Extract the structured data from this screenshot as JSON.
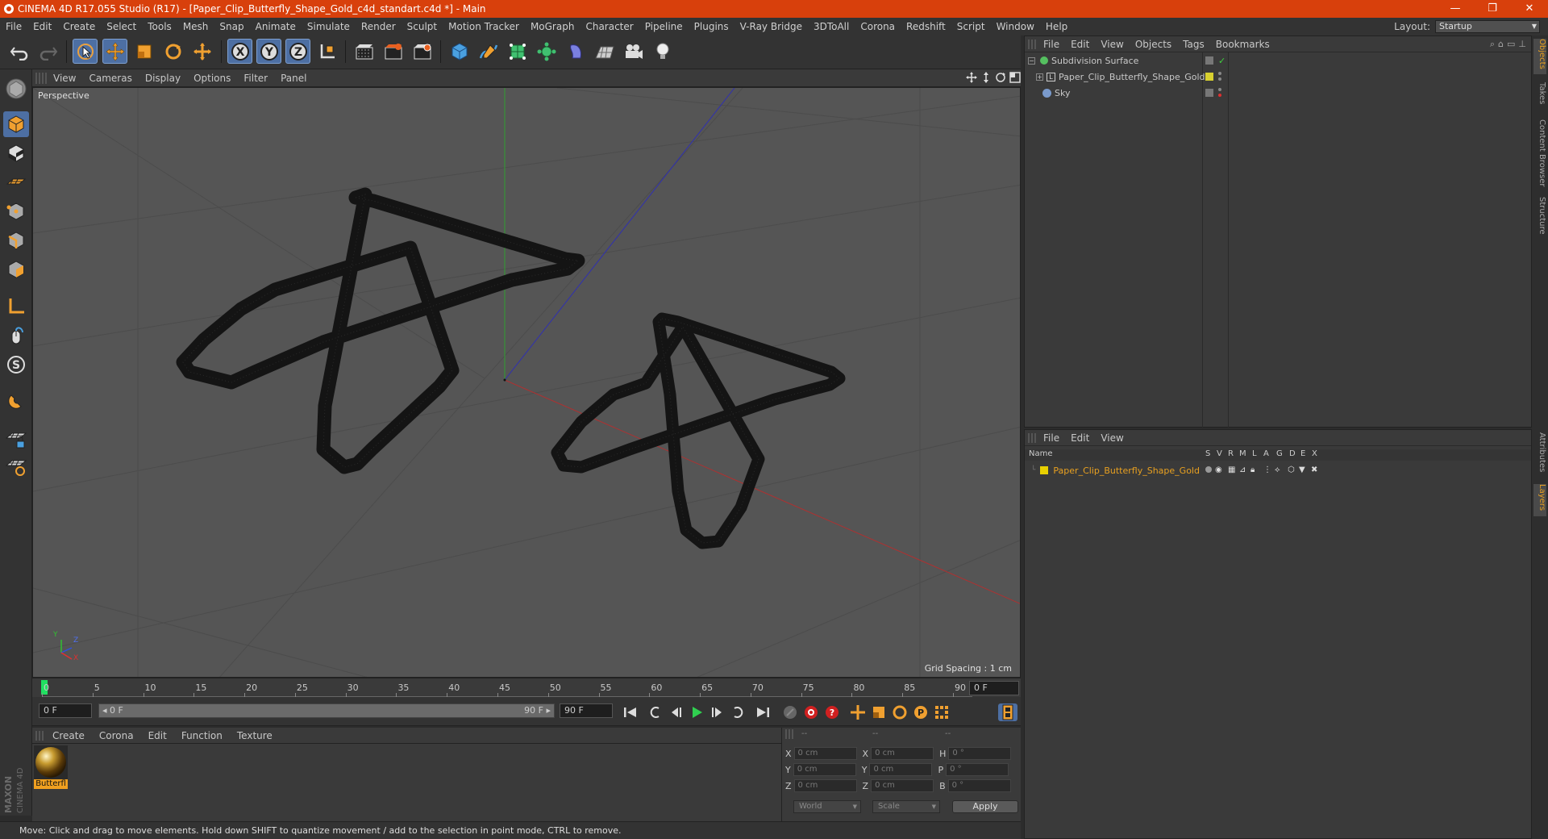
{
  "window": {
    "title": "CINEMA 4D R17.055 Studio (R17) - [Paper_Clip_Butterfly_Shape_Gold_c4d_standart.c4d *] - Main",
    "controls": [
      "—",
      "❐",
      "✕"
    ]
  },
  "menubar": [
    "File",
    "Edit",
    "Create",
    "Select",
    "Tools",
    "Mesh",
    "Snap",
    "Animate",
    "Simulate",
    "Render",
    "Sculpt",
    "Motion Tracker",
    "MoGraph",
    "Character",
    "Pipeline",
    "Plugins",
    "V-Ray Bridge",
    "3DToAll",
    "Corona",
    "Redshift",
    "Script",
    "Window",
    "Help"
  ],
  "layout": {
    "label": "Layout:",
    "value": "Startup"
  },
  "toolbar": {
    "icons": [
      "undo-icon",
      "redo-icon",
      "select-arrow-icon",
      "move-icon",
      "scale-icon",
      "rotate-icon",
      "transform-icon",
      "axis-x-icon",
      "axis-y-icon",
      "axis-z-icon",
      "coordinate-system-icon",
      "render-view-icon",
      "render-picture-viewer-icon",
      "render-settings-icon",
      "cube-primitive-icon",
      "pen-spline-icon",
      "subdivision-icon",
      "array-icon",
      "deformer-icon",
      "floor-icon",
      "camera-icon",
      "light-icon"
    ],
    "axis_labels": [
      "X",
      "Y",
      "Z"
    ]
  },
  "left_tools": [
    "make-editable-icon",
    "model-mode-icon",
    "texture-mode-icon",
    "workplane-mode-icon",
    "points-mode-icon",
    "edges-mode-icon",
    "polygons-mode-icon",
    "axis-mode-icon",
    "tweak-mode-icon",
    "solo-icon",
    "snap-icon",
    "lock-workplane-icon",
    "planar-workplane-icon"
  ],
  "solo_label": "S",
  "maxon_logo": "MAXON CINEMA 4D",
  "viewport": {
    "menu": [
      "View",
      "Cameras",
      "Display",
      "Options",
      "Filter",
      "Panel"
    ],
    "camera_label": "Perspective",
    "grid_spacing": "Grid Spacing : 1 cm",
    "axis_gizmo": {
      "y": "Y",
      "z": "Z",
      "x": "X"
    }
  },
  "timeline": {
    "ticks": [
      "0",
      "5",
      "10",
      "15",
      "20",
      "25",
      "30",
      "35",
      "40",
      "45",
      "50",
      "55",
      "60",
      "65",
      "70",
      "75",
      "80",
      "85",
      "90"
    ],
    "current_frame": "0 F"
  },
  "playbar": {
    "start_frame": "0 F",
    "range_start": "◂ 0 F",
    "range_end": "90 F ▸",
    "end_frame": "90 F"
  },
  "materials": {
    "menu": [
      "Create",
      "Corona",
      "Edit",
      "Function",
      "Texture"
    ],
    "items": [
      {
        "label": "Butterfl"
      }
    ]
  },
  "coordinates": {
    "headers": [
      "--",
      "--",
      "--"
    ],
    "rows": [
      {
        "a": "X",
        "av": "0 cm",
        "b": "X",
        "bv": "0 cm",
        "c": "H",
        "cv": "0 °"
      },
      {
        "a": "Y",
        "av": "0 cm",
        "b": "Y",
        "bv": "0 cm",
        "c": "P",
        "cv": "0 °"
      },
      {
        "a": "Z",
        "av": "0 cm",
        "b": "Z",
        "bv": "0 cm",
        "c": "B",
        "cv": "0 °"
      }
    ],
    "mode": "World",
    "scale": "Scale",
    "apply": "Apply"
  },
  "status": "Move: Click and drag to move elements. Hold down SHIFT to quantize movement / add to the selection in point mode, CTRL to remove.",
  "objects_panel": {
    "menu": [
      "File",
      "Edit",
      "View",
      "Objects",
      "Tags",
      "Bookmarks"
    ],
    "items": [
      {
        "name": "Subdivision Surface",
        "color": "#55c060"
      },
      {
        "name": "Paper_Clip_Butterfly_Shape_Gold",
        "color": "#d8d030"
      },
      {
        "name": "Sky",
        "color": "#7a9acc"
      }
    ]
  },
  "layers_panel": {
    "menu": [
      "File",
      "Edit",
      "View"
    ],
    "columns": [
      "Name",
      "S",
      "V",
      "R",
      "M",
      "L",
      "A",
      "G",
      "D",
      "E",
      "X"
    ],
    "items": [
      {
        "name": "Paper_Clip_Butterfly_Shape_Gold",
        "color": "#e8d000"
      }
    ]
  },
  "side_tabs": [
    "Objects",
    "Takes",
    "Content Browser",
    "Structure",
    "Attributes",
    "Layers"
  ],
  "colors": {
    "accent": "#d8400c",
    "selection": "#4d6fa3",
    "layer_text": "#e8a020"
  }
}
